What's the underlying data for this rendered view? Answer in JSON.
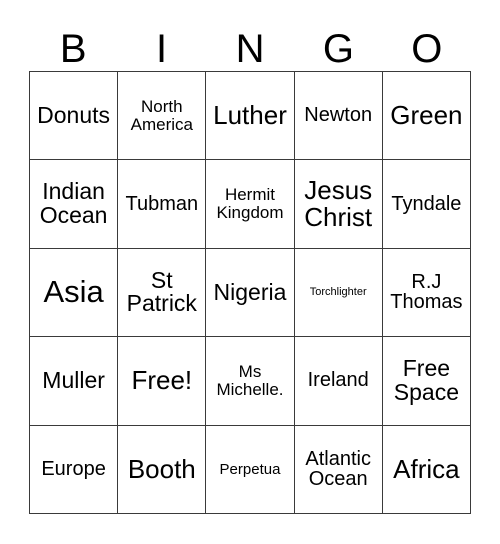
{
  "card": {
    "header_letters": [
      "B",
      "I",
      "N",
      "G",
      "O"
    ],
    "rows": [
      [
        {
          "text": "Donuts",
          "size": "l"
        },
        {
          "text": "North\nAmerica",
          "size": "s"
        },
        {
          "text": "Luther",
          "size": "xl"
        },
        {
          "text": "Newton",
          "size": "m"
        },
        {
          "text": "Green",
          "size": "xl"
        }
      ],
      [
        {
          "text": "Indian\nOcean",
          "size": "l"
        },
        {
          "text": "Tubman",
          "size": "m"
        },
        {
          "text": "Hermit\nKingdom",
          "size": "s"
        },
        {
          "text": "Jesus\nChrist",
          "size": "xl"
        },
        {
          "text": "Tyndale",
          "size": "m"
        }
      ],
      [
        {
          "text": "Asia",
          "size": "xxl"
        },
        {
          "text": "St\nPatrick",
          "size": "l"
        },
        {
          "text": "Nigeria",
          "size": "l"
        },
        {
          "text": "Torchlighter",
          "size": "xxs"
        },
        {
          "text": "R.J\nThomas",
          "size": "m"
        }
      ],
      [
        {
          "text": "Muller",
          "size": "l"
        },
        {
          "text": "Free!",
          "size": "xl"
        },
        {
          "text": "Ms\nMichelle.",
          "size": "s"
        },
        {
          "text": "Ireland",
          "size": "m"
        },
        {
          "text": "Free\nSpace",
          "size": "l"
        }
      ],
      [
        {
          "text": "Europe",
          "size": "m"
        },
        {
          "text": "Booth",
          "size": "xl"
        },
        {
          "text": "Perpetua",
          "size": "xs"
        },
        {
          "text": "Atlantic\nOcean",
          "size": "m"
        },
        {
          "text": "Africa",
          "size": "xl"
        }
      ]
    ]
  },
  "colors": {
    "background": "#ffffff",
    "text": "#000000",
    "grid_line": "#3a3a3a"
  }
}
